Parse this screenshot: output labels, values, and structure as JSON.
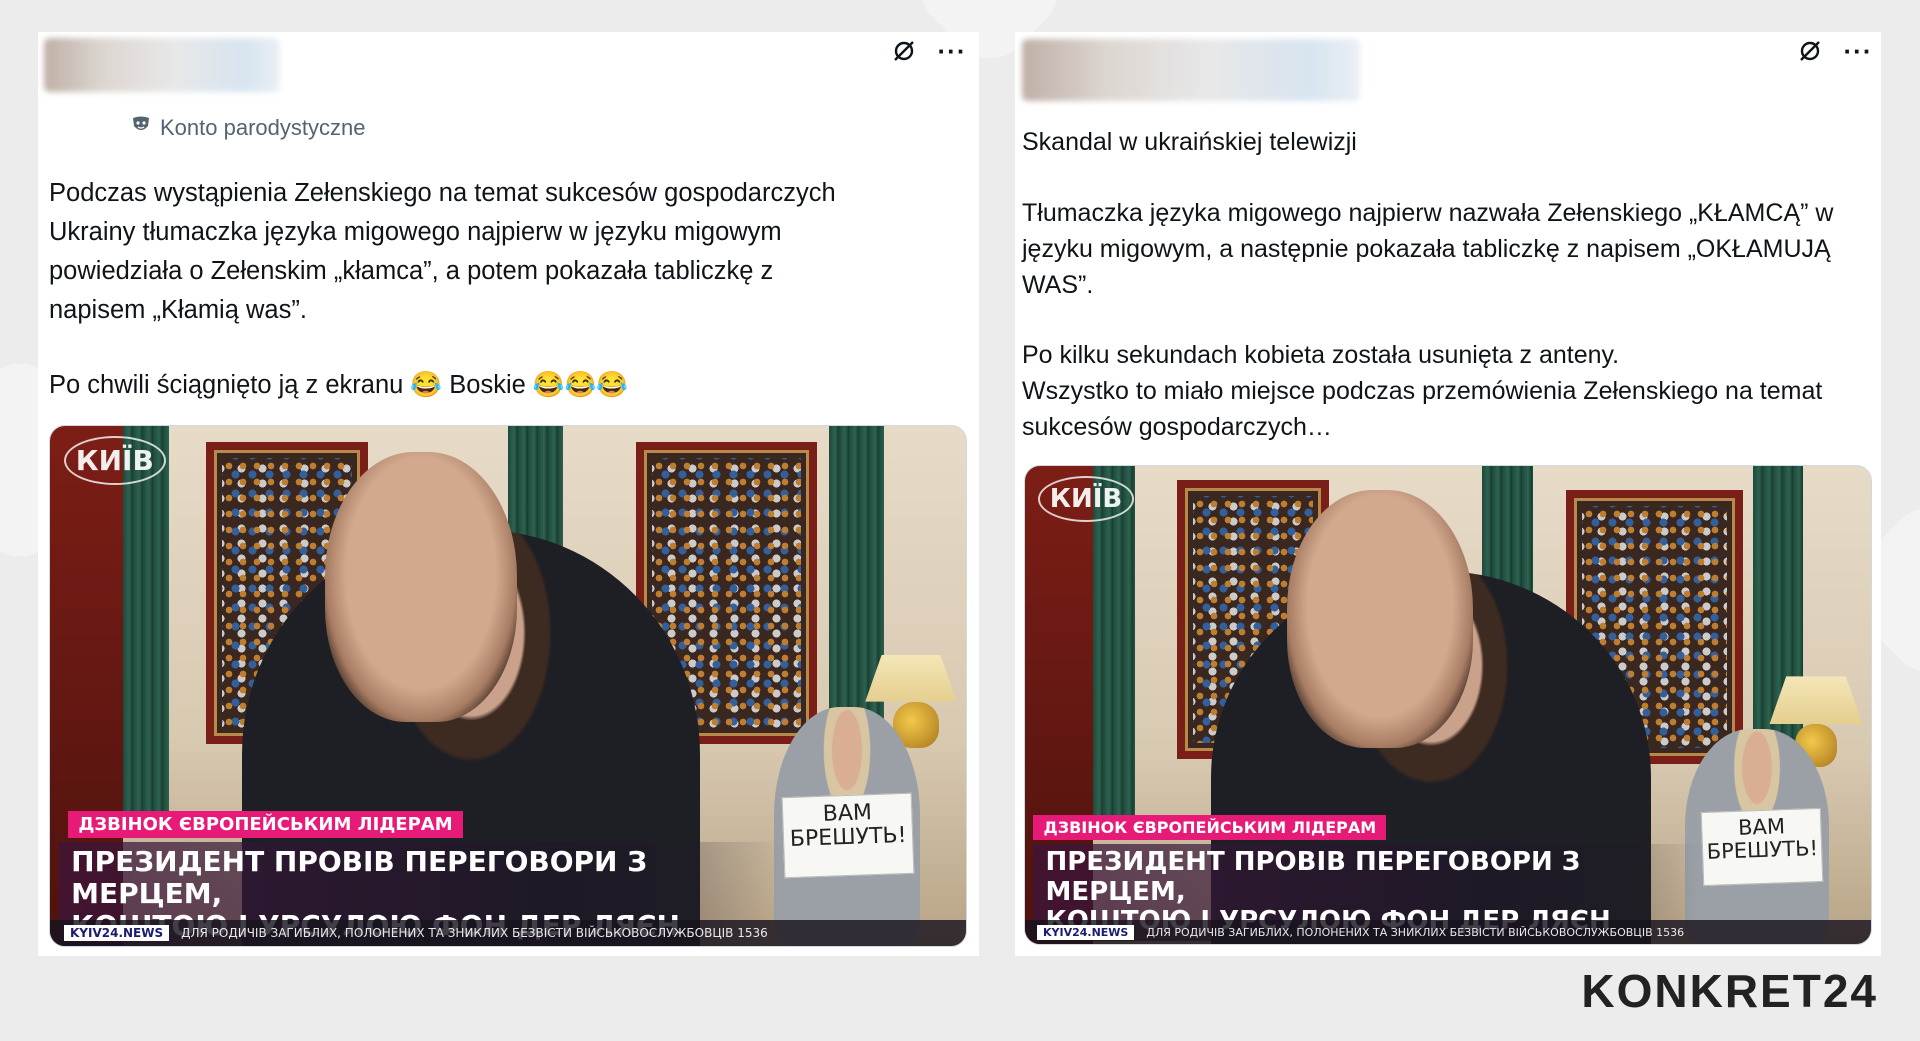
{
  "posts": [
    {
      "account_badge": "Konto parodystyczne",
      "paragraph1": "Podczas wystąpienia Zełenskiego na temat sukcesów gospodarczych\nUkrainy tłumaczka języka migowego najpierw w języku migowym\npowiedziała o Zełenskim „kłamca”, a potem pokazała tabliczkę z\nnapisem „Kłamią was”.",
      "paragraph2": "Po chwili ściągnięto ją z ekranu 😂 Boskie  😂😂😂",
      "video": {
        "channel_logo": "КИЇВ",
        "badge": "ДЗВІНОК ЄВРОПЕЙСЬКИМ ЛІДЕРАМ",
        "headline_line1": "ПРЕЗИДЕНТ ПРОВІВ ПЕРЕГОВОРИ З МЕРЦЕМ,",
        "headline_line2": "КОШТОЮ І УРСУЛОЮ ФОН ДЕР ЛЯЄН",
        "ticker_logo": "KYIV24.NEWS",
        "ticker_text": "ДЛЯ РОДИЧІВ ЗАГИБЛИХ, ПОЛОНЕНИХ ТА ЗНИКЛИХ БЕЗВІСТИ ВІЙСЬКОВОСЛУЖБОВЦІВ 1536",
        "sign_line1": "ВАМ",
        "sign_line2": "БРЕШУТЬ!"
      }
    },
    {
      "paragraph1": "Skandal w ukraińskiej telewizji",
      "paragraph2": "Tłumaczka języka migowego najpierw nazwała Zełenskiego „KŁAMCĄ” w\njęzyku migowym, a następnie pokazała tabliczkę z napisem „OKŁAMUJĄ\nWAS”.",
      "paragraph3": "Po kilku sekundach kobieta została usunięta z anteny.\nWszystko to miało miejsce podczas przemówienia Zełenskiego na temat\nsukcesów gospodarczych…",
      "video": {
        "channel_logo": "КИЇВ",
        "badge": "ДЗВІНОК ЄВРОПЕЙСЬКИМ ЛІДЕРАМ",
        "headline_line1": "ПРЕЗИДЕНТ ПРОВІВ ПЕРЕГОВОРИ З МЕРЦЕМ,",
        "headline_line2": "КОШТОЮ І УРСУЛОЮ ФОН ДЕР ЛЯЄН",
        "ticker_logo": "KYIV24.NEWS",
        "ticker_text": "ДЛЯ РОДИЧІВ ЗАГИБЛИХ, ПОЛОНЕНИХ ТА ЗНИКЛИХ БЕЗВІСТИ ВІЙСЬКОВОСЛУЖБОВЦІВ 1536",
        "sign_line1": "ВАМ",
        "sign_line2": "БРЕШУТЬ!"
      }
    }
  ],
  "icons": {
    "grok": "grok-icon",
    "more": "more-options-icon",
    "parody_badge": "parody-mask-icon"
  },
  "more_glyph": "···",
  "brand": "KONKRET24",
  "colors": {
    "background": "#ececec",
    "card": "#ffffff",
    "text": "#0f1419",
    "muted": "#536471",
    "tv_badge": "#e81a78"
  }
}
